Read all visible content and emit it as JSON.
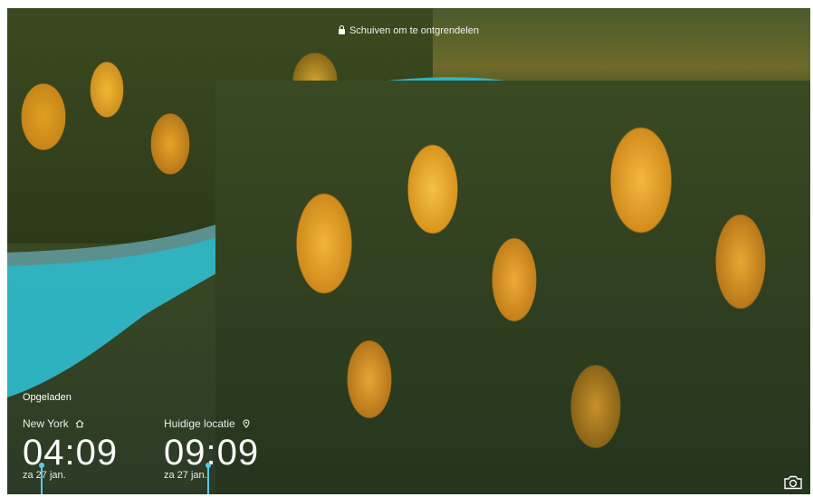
{
  "lockscreen": {
    "unlock_hint": "Schuiven om te ontgrendelen",
    "charging_status": "Opgeladen",
    "clocks": [
      {
        "city": "New York",
        "icon": "home-icon",
        "time": "04:09",
        "date": "za 27 jan."
      },
      {
        "city": "Huidige locatie",
        "icon": "location-pin-icon",
        "time": "09:09",
        "date": "za 27 jan."
      }
    ],
    "camera_shortcut_icon": "camera-icon"
  },
  "colors": {
    "accent": "#5fc6e8",
    "river": "#2fb8c8"
  }
}
